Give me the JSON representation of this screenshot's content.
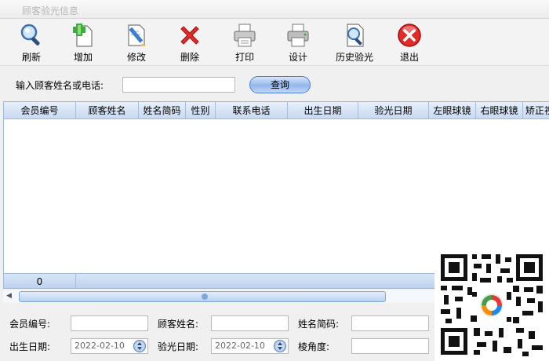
{
  "window": {
    "title": "顾客验光信息"
  },
  "toolbar": {
    "buttons": [
      {
        "id": "refresh",
        "label": "刷新",
        "icon": "magnifier-icon"
      },
      {
        "id": "add",
        "label": "增加",
        "icon": "add-document-icon"
      },
      {
        "id": "edit",
        "label": "修改",
        "icon": "edit-pencil-icon"
      },
      {
        "id": "delete",
        "label": "删除",
        "icon": "red-x-icon"
      },
      {
        "id": "print",
        "label": "打印",
        "icon": "printer-icon"
      },
      {
        "id": "design",
        "label": "设计",
        "icon": "printer-design-icon"
      },
      {
        "id": "history",
        "label": "历史验光",
        "icon": "magnifier-document-icon"
      },
      {
        "id": "exit",
        "label": "退出",
        "icon": "close-circle-icon"
      }
    ]
  },
  "search": {
    "label": "输入顾客姓名或电话:",
    "value": "",
    "button_label": "查询"
  },
  "grid": {
    "columns": [
      "会员编号",
      "顾客姓名",
      "姓名简码",
      "性别",
      "联系电话",
      "出生日期",
      "验光日期",
      "左眼球镜",
      "右眼球镜",
      "矫正视"
    ],
    "rows": [],
    "footer_count": "0"
  },
  "form": {
    "member_no_label": "会员编号:",
    "customer_name_label": "顾客姓名:",
    "name_code_label": "姓名简码:",
    "birth_date_label": "出生日期:",
    "birth_date_value": "2022-02-10",
    "exam_date_label": "验光日期:",
    "exam_date_value": "2022-02-10",
    "prism_label": "棱角度:"
  },
  "colors": {
    "accent": "#4a7fd0",
    "header_bg": "#c8d9f1",
    "delete_red": "#e02b2b"
  }
}
